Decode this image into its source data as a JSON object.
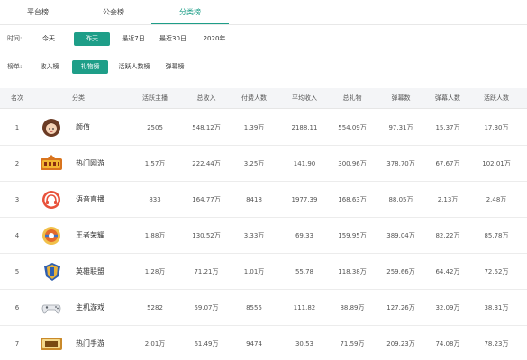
{
  "tabs": [
    {
      "label": "平台榜",
      "active": false
    },
    {
      "label": "公会榜",
      "active": false
    },
    {
      "label": "分类榜",
      "active": true
    }
  ],
  "filters": {
    "time_label": "时间:",
    "time_options": [
      {
        "label": "今天",
        "active": false
      },
      {
        "label": "昨天",
        "active": true
      },
      {
        "label": "最近7日",
        "active": false
      },
      {
        "label": "最近30日",
        "active": false
      },
      {
        "label": "2020年",
        "active": false
      }
    ],
    "rank_label": "榜单:",
    "rank_options": [
      {
        "label": "收入榜",
        "active": false
      },
      {
        "label": "礼物榜",
        "active": true
      },
      {
        "label": "活跃人数榜",
        "active": false
      },
      {
        "label": "弹幕榜",
        "active": false
      }
    ]
  },
  "table": {
    "headers": [
      "名次",
      "分类",
      "活跃主播",
      "总收入",
      "付费人数",
      "平均收入",
      "总礼物",
      "弹幕数",
      "弹幕人数",
      "活跃人数"
    ],
    "rows": [
      {
        "rank": "1",
        "name": "颜值",
        "icon": "avatar-girl-icon",
        "cells": [
          "2505",
          "548.12万",
          "1.39万",
          "2188.11",
          "554.09万",
          "97.31万",
          "15.37万",
          "17.30万"
        ]
      },
      {
        "rank": "2",
        "name": "热门网游",
        "icon": "game-logo-icon",
        "cells": [
          "1.57万",
          "222.44万",
          "3.25万",
          "141.90",
          "300.96万",
          "378.70万",
          "67.67万",
          "102.01万"
        ]
      },
      {
        "rank": "3",
        "name": "语音直播",
        "icon": "headphones-icon",
        "cells": [
          "833",
          "164.77万",
          "8418",
          "1977.39",
          "168.63万",
          "88.05万",
          "2.13万",
          "2.48万"
        ]
      },
      {
        "rank": "4",
        "name": "王者荣耀",
        "icon": "kings-glory-icon",
        "cells": [
          "1.88万",
          "130.52万",
          "3.33万",
          "69.33",
          "159.95万",
          "389.04万",
          "82.22万",
          "85.78万"
        ]
      },
      {
        "rank": "5",
        "name": "英雄联盟",
        "icon": "lol-shield-icon",
        "cells": [
          "1.28万",
          "71.21万",
          "1.01万",
          "55.78",
          "118.38万",
          "259.66万",
          "64.42万",
          "72.52万"
        ]
      },
      {
        "rank": "6",
        "name": "主机游戏",
        "icon": "gamepad-icon",
        "cells": [
          "5282",
          "59.07万",
          "8555",
          "111.82",
          "88.89万",
          "127.26万",
          "32.09万",
          "38.31万"
        ]
      },
      {
        "rank": "7",
        "name": "热门手游",
        "icon": "tablet-icon",
        "cells": [
          "2.01万",
          "61.49万",
          "9474",
          "30.53",
          "71.59万",
          "209.23万",
          "74.08万",
          "78.23万"
        ]
      }
    ]
  },
  "colors": {
    "accent": "#1e9e88",
    "header_bg": "#f4f5f7"
  }
}
